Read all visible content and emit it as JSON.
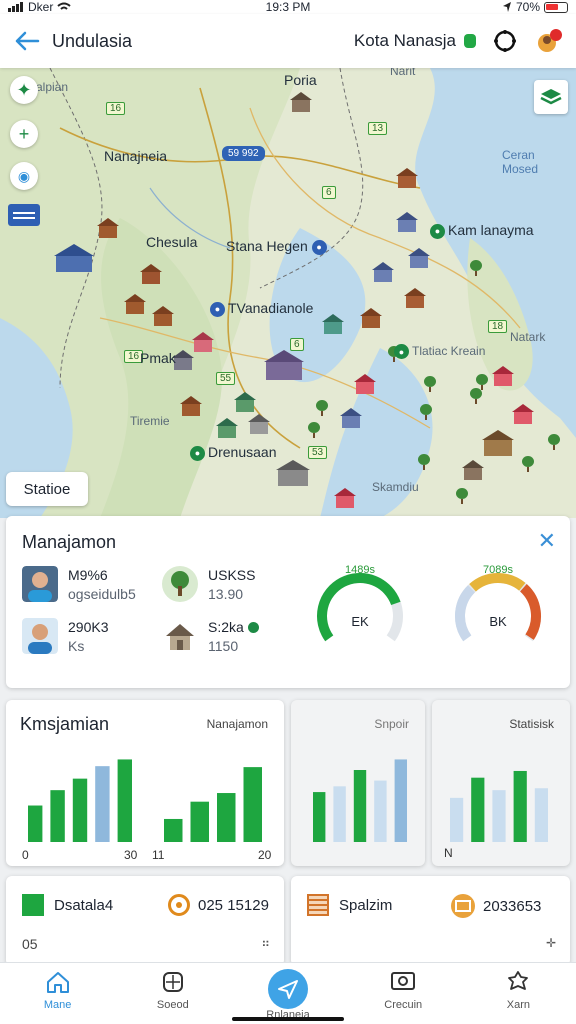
{
  "status_bar": {
    "carrier": "Dker",
    "time": "19:3 PM",
    "battery": "70%"
  },
  "header": {
    "title": "Undulasia",
    "city": "Kota Nanasja"
  },
  "map": {
    "labels": [
      {
        "text": "Poria",
        "kind": "city"
      },
      {
        "text": "Narit",
        "kind": "small"
      },
      {
        "text": "Nanajneia",
        "kind": "city"
      },
      {
        "text": "Chesula",
        "kind": "city"
      },
      {
        "text": "Stana Hegen",
        "kind": "city",
        "pin": "blue"
      },
      {
        "text": "Kam lanayma",
        "kind": "city",
        "pin": "green"
      },
      {
        "text": "TVanadianole",
        "kind": "city",
        "pin": "blue"
      },
      {
        "text": "Tlatiac Kreain",
        "kind": "small",
        "pin": "green"
      },
      {
        "text": "Natark",
        "kind": "small"
      },
      {
        "text": "Pmak",
        "kind": "city"
      },
      {
        "text": "Tiremie",
        "kind": "small"
      },
      {
        "text": "Drenusaan",
        "kind": "city",
        "pin": "green"
      },
      {
        "text": "Skamdiu",
        "kind": "small"
      },
      {
        "text": "Ceran Mosed",
        "kind": "sea"
      },
      {
        "text": "alpian",
        "kind": "small"
      }
    ],
    "road_tags": [
      "16",
      "13",
      "59 992",
      "6",
      "18",
      "55",
      "53",
      "16",
      "6"
    ],
    "station_chip": "Statioe",
    "layers_icon": "layers-icon",
    "controls": [
      "compass-icon",
      "zoom-in-icon",
      "location-icon",
      "legend-icon"
    ]
  },
  "management": {
    "title": "Manajamon",
    "stats": [
      {
        "line1": "M9%6",
        "line2": "ogseidulb5",
        "icon": "person-avatar"
      },
      {
        "line1": "USKSS",
        "line2": "13.90",
        "icon": "tree-icon"
      },
      {
        "line1": "290K3",
        "line2": "Ks",
        "icon": "person-avatar"
      },
      {
        "line1": "S:2ka",
        "line2": "1150",
        "icon": "house-icon"
      }
    ],
    "gauges": [
      {
        "top": "1489s",
        "center": "EK",
        "value": 0.78,
        "colors": [
          "#1ea640"
        ]
      },
      {
        "top": "7089s",
        "center": "BK",
        "value": 0.7,
        "colors": [
          "#c8d7ea",
          "#e6b43a",
          "#d95b2b"
        ]
      }
    ]
  },
  "charts": [
    {
      "title": "Kmsjamian",
      "subtitle": "Nanajamon",
      "chart_data": [
        {
          "type": "bar",
          "categories": [
            "1",
            "2",
            "3",
            "4",
            "5"
          ],
          "values": [
            38,
            54,
            66,
            79,
            86
          ],
          "colors": [
            "#1ea640",
            "#1ea640",
            "#1ea640",
            "#8fb8dc",
            "#1ea640"
          ],
          "xlabel_left": "0",
          "xlabel_right": "30",
          "ylim": [
            0,
            100
          ]
        },
        {
          "type": "bar",
          "categories": [
            "1",
            "2",
            "3",
            "4"
          ],
          "values": [
            24,
            42,
            51,
            78
          ],
          "colors": [
            "#1ea640",
            "#1ea640",
            "#1ea640",
            "#1ea640"
          ],
          "xlabel_left": "11",
          "xlabel_right": "20",
          "ylim": [
            0,
            100
          ]
        }
      ]
    },
    {
      "title": "",
      "subtitle": "Snpoir",
      "chart_data": {
        "type": "bar",
        "categories": [
          "1",
          "2",
          "3",
          "4",
          "5"
        ],
        "values": [
          52,
          58,
          75,
          64,
          86
        ],
        "colors": [
          "#1ea640",
          "#c9ddef",
          "#1ea640",
          "#c9ddef",
          "#8fb8dc"
        ],
        "ylim": [
          0,
          100
        ]
      }
    },
    {
      "title": "",
      "subtitle": "Statisisk",
      "chart_data": {
        "type": "bar",
        "categories": [
          "1",
          "2",
          "3",
          "4",
          "5"
        ],
        "values": [
          46,
          67,
          54,
          74,
          56
        ],
        "colors": [
          "#c9ddef",
          "#1ea640",
          "#c9ddef",
          "#1ea640",
          "#c9ddef"
        ],
        "xlabel_left": "N",
        "ylim": [
          0,
          100
        ]
      }
    }
  ],
  "bottom_cards": [
    {
      "label": "Dsatala4",
      "value": "025 15129",
      "footer": "05",
      "icon_left": "green-square-icon",
      "icon_right": "target-icon"
    },
    {
      "label": "Spalzim",
      "value": "2033653",
      "icon_left": "list-icon",
      "icon_right": "coin-icon"
    }
  ],
  "nav": [
    {
      "label": "Mane",
      "icon": "home-icon",
      "active": true
    },
    {
      "label": "Soeod",
      "icon": "calculator-icon",
      "active": false
    },
    {
      "label": "Rnlaneia",
      "icon": "send-icon",
      "active": false
    },
    {
      "label": "Crecuin",
      "icon": "screen-icon",
      "active": false
    },
    {
      "label": "Xarn",
      "icon": "puzzle-icon",
      "active": false
    }
  ]
}
